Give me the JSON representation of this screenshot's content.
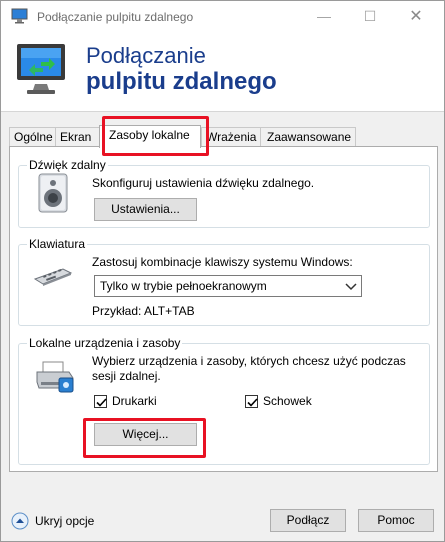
{
  "window": {
    "title": "Podłączanie pulpitu zdalnego",
    "controls": {
      "minimize": "—",
      "maximize": "☐",
      "close": "✕"
    }
  },
  "banner": {
    "line1": "Podłączanie",
    "line2": "pulpitu zdalnego"
  },
  "tabs": [
    {
      "label": "Ogólne"
    },
    {
      "label": "Ekran"
    },
    {
      "label": "Zasoby lokalne",
      "active": true
    },
    {
      "label": "Wrażenia"
    },
    {
      "label": "Zaawansowane"
    }
  ],
  "audio": {
    "title": "Dźwięk zdalny",
    "description": "Skonfiguruj ustawienia dźwięku zdalnego.",
    "settings_button": "Ustawienia..."
  },
  "keyboard": {
    "title": "Klawiatura",
    "description": "Zastosuj kombinacje klawiszy systemu Windows:",
    "selected_option": "Tylko w trybie pełnoekranowym",
    "example": "Przykład: ALT+TAB"
  },
  "devices": {
    "title": "Lokalne urządzenia i zasoby",
    "description_line1": "Wybierz urządzenia i zasoby, których chcesz użyć podczas",
    "description_line2": "sesji zdalnej.",
    "printers_label": "Drukarki",
    "printers_checked": true,
    "clipboard_label": "Schowek",
    "clipboard_checked": true,
    "more_button": "Więcej..."
  },
  "bottom": {
    "hide_options": "Ukryj opcje",
    "connect_button": "Podłącz",
    "help_button": "Pomoc"
  },
  "colors": {
    "highlight": "#e81123",
    "banner_text": "#1a3d8c"
  }
}
